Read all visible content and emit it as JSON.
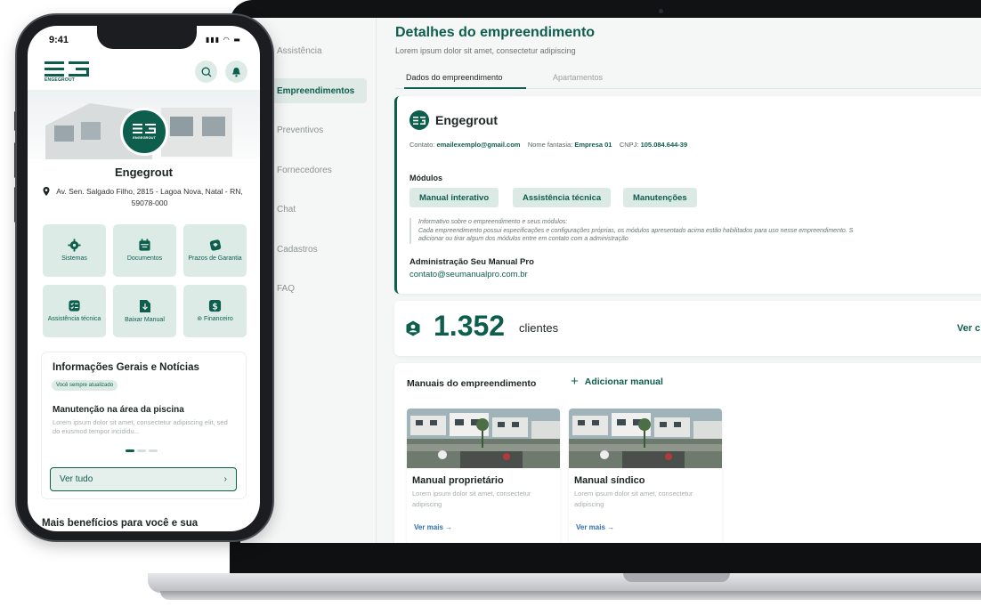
{
  "web": {
    "sidebar": {
      "items": [
        {
          "label": "Assistência",
          "active": false
        },
        {
          "label": "Empreendimentos",
          "active": true
        },
        {
          "label": "Preventivos",
          "active": false
        },
        {
          "label": "Fornecedores",
          "active": false
        },
        {
          "label": "Chat",
          "active": false
        },
        {
          "label": "Cadastros",
          "active": false
        },
        {
          "label": "FAQ",
          "active": false
        }
      ]
    },
    "page_title": "Detalhes do empreendimento",
    "page_subtitle": "Lorem ipsum dolor sit amet, consectetur adipiscing",
    "tabs": [
      {
        "label": "Dados do empreendimento",
        "active": true
      },
      {
        "label": "Apartamentos",
        "active": false
      }
    ],
    "details": {
      "name": "Engegrout",
      "logo_text": "EG",
      "contact_label": "Contato:",
      "contact_value": "emailexemplo@gmail.com",
      "fantasy_label": "Nome fantasia:",
      "fantasy_value": "Empresa 01",
      "cnpj_label": "CNPJ:",
      "cnpj_value": "105.084.644-39",
      "modules_title": "Módulos",
      "modules": [
        "Manual interativo",
        "Assistência técnica",
        "Manutenções"
      ],
      "info_line1": "Informativo sobre o empreendimento e seus módulos:",
      "info_line2": "Cada empreendimento possui especificações e configurações próprias, os módulos apresentado acima estão habilitados para uso nesse empreendimento. S",
      "info_line3": "adicionar ou tirar algum dos módulos entre em contato com a administração",
      "admin_title": "Administração Seu Manual Pro",
      "admin_email": "contato@seumanualpro.com.br"
    },
    "clients": {
      "count": "1.352",
      "label": "clientes",
      "link": "Ver c"
    },
    "manuals": {
      "title": "Manuais do empreendimento",
      "add_label": "Adicionar manual",
      "items": [
        {
          "name": "Manual proprietário",
          "desc": "Lorem ipsum dolor sit amet, consectetur adipiscing",
          "more": "Ver mais"
        },
        {
          "name": "Manual síndico",
          "desc": "Lorem ipsum dolor sit amet, consectetur adipiscing",
          "more": "Ver mais"
        }
      ]
    }
  },
  "phone": {
    "time": "9:41",
    "status_icons": "▮▮▮ ◠ ▬",
    "brand": "ENGEGROUT",
    "name": "Engegrout",
    "address": "Av. Sen. Salgado Filho, 2815 - Lagoa Nova, Natal - RN, 59078-000",
    "hero_logo_text": "ENGEGROUT",
    "tiles": [
      {
        "label": "Sistemas",
        "icon": "gear-icon"
      },
      {
        "label": "Documentos",
        "icon": "calendar-icon"
      },
      {
        "label": "Prazos de Garantia",
        "icon": "warranty-icon"
      },
      {
        "label": "Assistência técnica",
        "icon": "checklist-icon"
      },
      {
        "label": "Baixar Manual",
        "icon": "download-icon"
      },
      {
        "label": "⊚ Financeiro",
        "icon": "dollar-icon"
      }
    ],
    "news": {
      "title": "Informações Gerais e Notícias",
      "badge": "Você sempre atualizado",
      "headline": "Manutenção na área da piscina",
      "body": "Lorem ipsum dolor sit amet, consectetur adipiscing elit, sed do eiusmod tempor incididu...",
      "see_all": "Ver tudo",
      "chevron": "›"
    },
    "more_benefits": "Mais benefícios para você e sua"
  },
  "colors": {
    "brand": "#0d5e4d",
    "chip_bg": "#dceae5",
    "link_blue": "#2f6fb0"
  }
}
